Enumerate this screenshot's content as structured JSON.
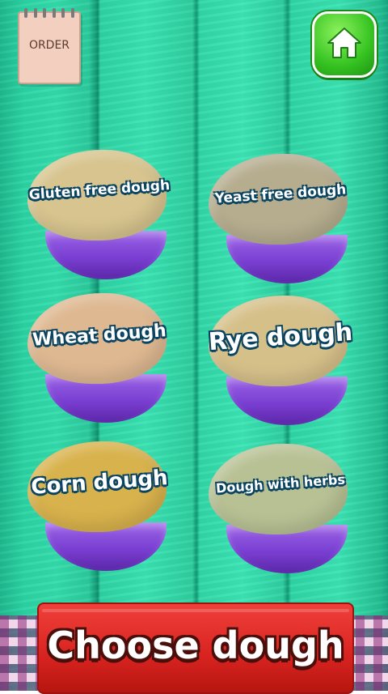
{
  "order": {
    "label": "ORDER"
  },
  "home": {
    "icon": "home-icon",
    "color": "#35c321"
  },
  "doughs": [
    {
      "label": "Gluten free dough",
      "color": "#d7c48e"
    },
    {
      "label": "Yeast free dough",
      "color": "#b6ad8f"
    },
    {
      "label": "Wheat dough",
      "color": "#deb891"
    },
    {
      "label": "Rye dough",
      "color": "#d6c08a"
    },
    {
      "label": "Corn dough",
      "color": "#d8b24c"
    },
    {
      "label": "Dough with herbs",
      "color": "#b8c194"
    }
  ],
  "bowl_color": "#7a3fd2",
  "banner": {
    "title": "Choose dough",
    "color": "#d72320"
  }
}
